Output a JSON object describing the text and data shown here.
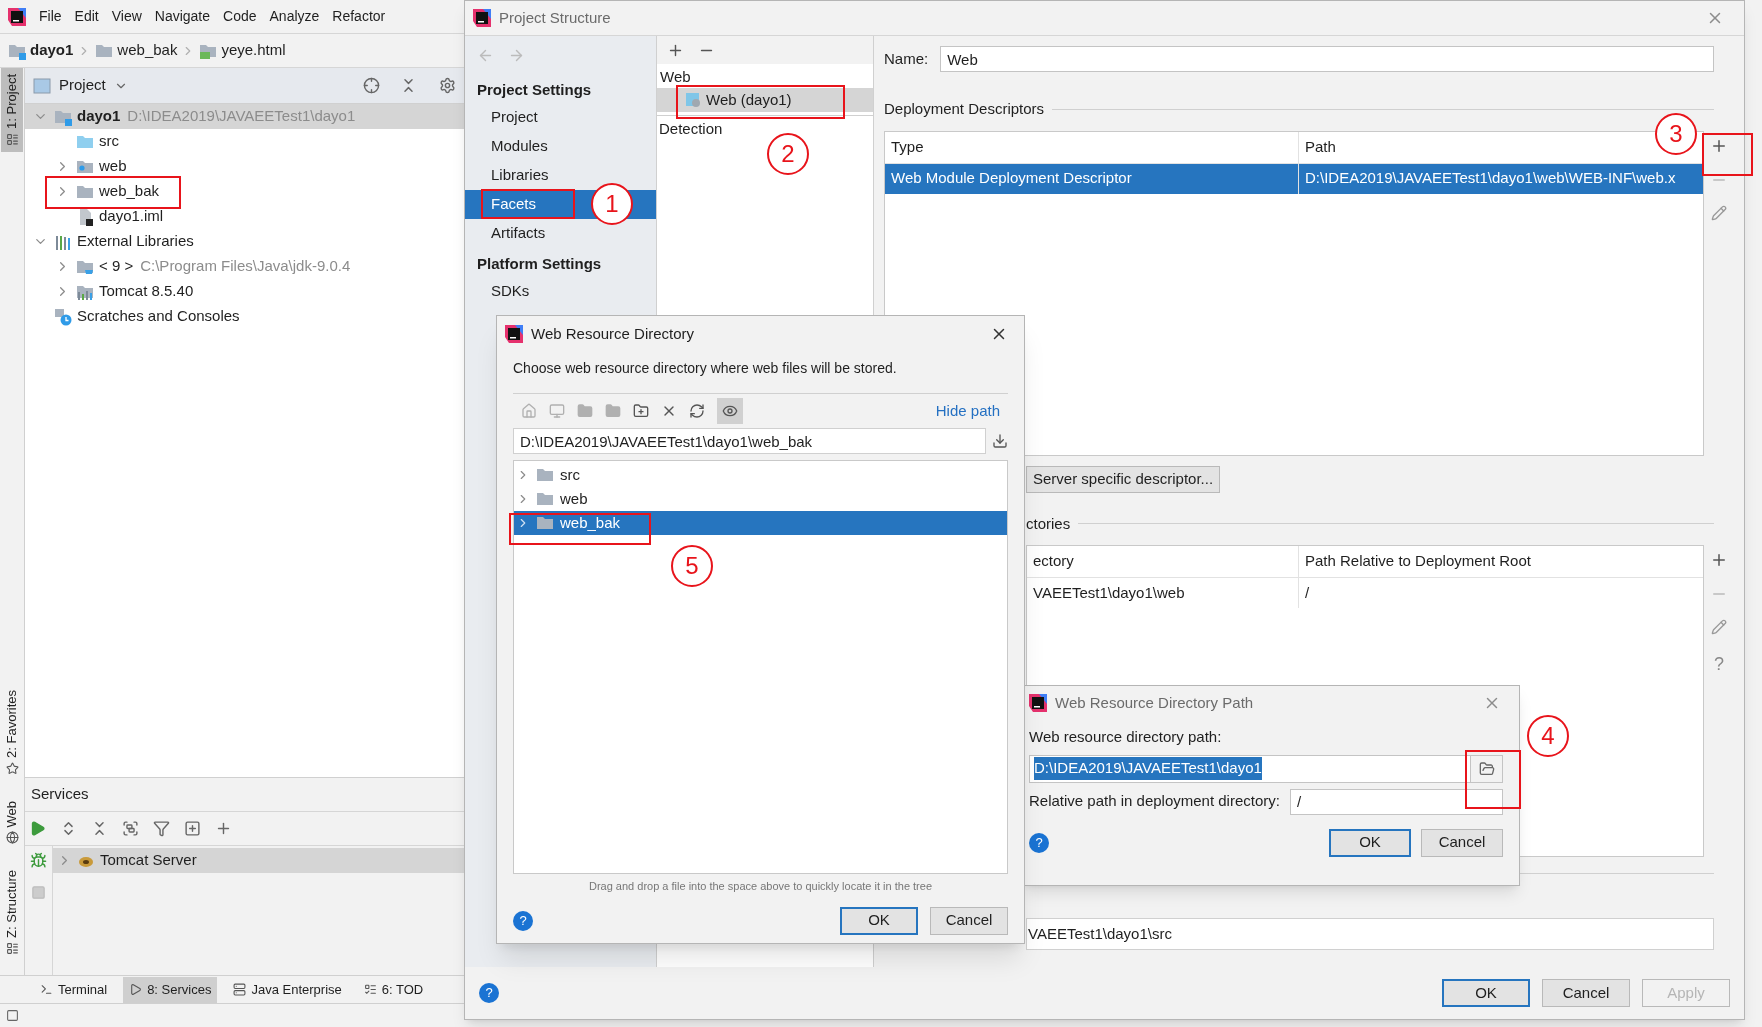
{
  "ide": {
    "menu": [
      "File",
      "Edit",
      "View",
      "Navigate",
      "Code",
      "Analyze",
      "Refactor"
    ],
    "breadcrumbs": [
      {
        "label": "dayo1",
        "kind": "module"
      },
      {
        "label": "web_bak",
        "kind": "folder"
      },
      {
        "label": "yeye.html",
        "kind": "html"
      }
    ],
    "side_tabs": [
      {
        "label": "1: Project",
        "selected": true
      },
      {
        "label": "2: Favorites",
        "selected": false
      },
      {
        "label": "Web",
        "selected": false
      },
      {
        "label": "Z: Structure",
        "selected": false
      }
    ],
    "project_panel": {
      "title": "Project",
      "tree": [
        {
          "label": "dayo1",
          "detail": "D:\\IDEA2019\\JAVAEETest1\\dayo1",
          "kind": "module",
          "selected": true,
          "expanded": true,
          "children": [
            {
              "label": "src",
              "kind": "source",
              "selected": false
            },
            {
              "label": "web",
              "kind": "web",
              "selected": false,
              "expanded": false
            },
            {
              "label": "web_bak",
              "kind": "folder",
              "selected": false,
              "expanded": false
            },
            {
              "label": "dayo1.iml",
              "kind": "file",
              "selected": false
            }
          ]
        },
        {
          "label": "External Libraries",
          "kind": "library",
          "selected": false,
          "expanded": true,
          "children": [
            {
              "label": "< 9 >",
              "detail": "C:\\Program Files\\Java\\jdk-9.0.4",
              "kind": "sdk",
              "selected": false,
              "expanded": false
            },
            {
              "label": "Tomcat 8.5.40",
              "kind": "tomcat",
              "selected": false,
              "expanded": false
            }
          ]
        },
        {
          "label": "Scratches and Consoles",
          "kind": "scratches",
          "selected": false
        }
      ]
    },
    "services": {
      "title": "Services",
      "tree": [
        {
          "label": "Tomcat Server",
          "selected": true,
          "expanded": false
        }
      ]
    },
    "bottom_tabs": [
      {
        "label": "Terminal",
        "kind": "terminal",
        "selected": false
      },
      {
        "label": "8: Services",
        "kind": "services",
        "selected": true
      },
      {
        "label": "Java Enterprise",
        "kind": "enterprise",
        "selected": false
      },
      {
        "label": "6: TOD",
        "kind": "todo",
        "selected": false
      }
    ]
  },
  "project_structure": {
    "title": "Project Structure",
    "nav": [
      {
        "kind": "header",
        "label": "Project Settings"
      },
      {
        "kind": "item",
        "label": "Project",
        "selected": false
      },
      {
        "kind": "item",
        "label": "Modules",
        "selected": false
      },
      {
        "kind": "item",
        "label": "Libraries",
        "selected": false
      },
      {
        "kind": "item",
        "label": "Facets",
        "selected": true
      },
      {
        "kind": "item",
        "label": "Artifacts",
        "selected": false
      },
      {
        "kind": "header",
        "label": "Platform Settings"
      },
      {
        "kind": "item",
        "label": "SDKs",
        "selected": false
      }
    ],
    "facets": {
      "group": "Web",
      "items": [
        {
          "label": "Web (dayo1)",
          "selected": true
        }
      ],
      "detection": "Detection"
    },
    "name": {
      "label": "Name:",
      "value": "Web"
    },
    "descriptors": {
      "title": "Deployment Descriptors",
      "columns": [
        "Type",
        "Path"
      ],
      "rows": [
        {
          "cells": [
            "Web Module Deployment Descriptor",
            "D:\\IDEA2019\\JAVAEETest1\\dayo1\\web\\WEB-INF\\web.x"
          ],
          "selected": true
        }
      ]
    },
    "server_button": "Server specific descriptor...",
    "directories": {
      "title": "ctories",
      "columns": [
        "ectory",
        "Path Relative to Deployment Root"
      ],
      "rows": [
        {
          "cells": [
            "VAEETest1\\dayo1\\web",
            "/"
          ],
          "selected": false
        }
      ]
    },
    "directories_help": "?",
    "source_root": "VAEETest1\\dayo1\\src",
    "help": "?",
    "buttons": [
      {
        "label": "OK",
        "default": true,
        "disabled": false
      },
      {
        "label": "Cancel",
        "default": false,
        "disabled": false
      },
      {
        "label": "Apply",
        "default": false,
        "disabled": true
      }
    ]
  },
  "path_dialog": {
    "title": "Web Resource Directory Path",
    "path_label": "Web resource directory path:",
    "path_value": "D:\\IDEA2019\\JAVAEETest1\\dayo1",
    "value_selected": true,
    "relative_label": "Relative path in deployment directory:",
    "relative_value": "/",
    "help": "?",
    "buttons": [
      {
        "label": "OK",
        "default": true
      },
      {
        "label": "Cancel",
        "default": false
      }
    ]
  },
  "directory_dialog": {
    "title": "Web Resource Directory",
    "description": "Choose web resource directory where web files will be stored.",
    "hidden_toggle_pressed": true,
    "hide_path": "Hide path",
    "path": "D:\\IDEA2019\\JAVAEETest1\\dayo1\\web_bak",
    "tree": [
      {
        "label": "src",
        "selected": false
      },
      {
        "label": "web",
        "selected": false
      },
      {
        "label": "web_bak",
        "selected": true
      }
    ],
    "hint": "Drag and drop a file into the space above to quickly locate it in the tree",
    "help": "?",
    "buttons": [
      {
        "label": "OK",
        "default": true
      },
      {
        "label": "Cancel",
        "default": false
      }
    ]
  },
  "annotations": [
    "1",
    "2",
    "3",
    "4",
    "5"
  ]
}
